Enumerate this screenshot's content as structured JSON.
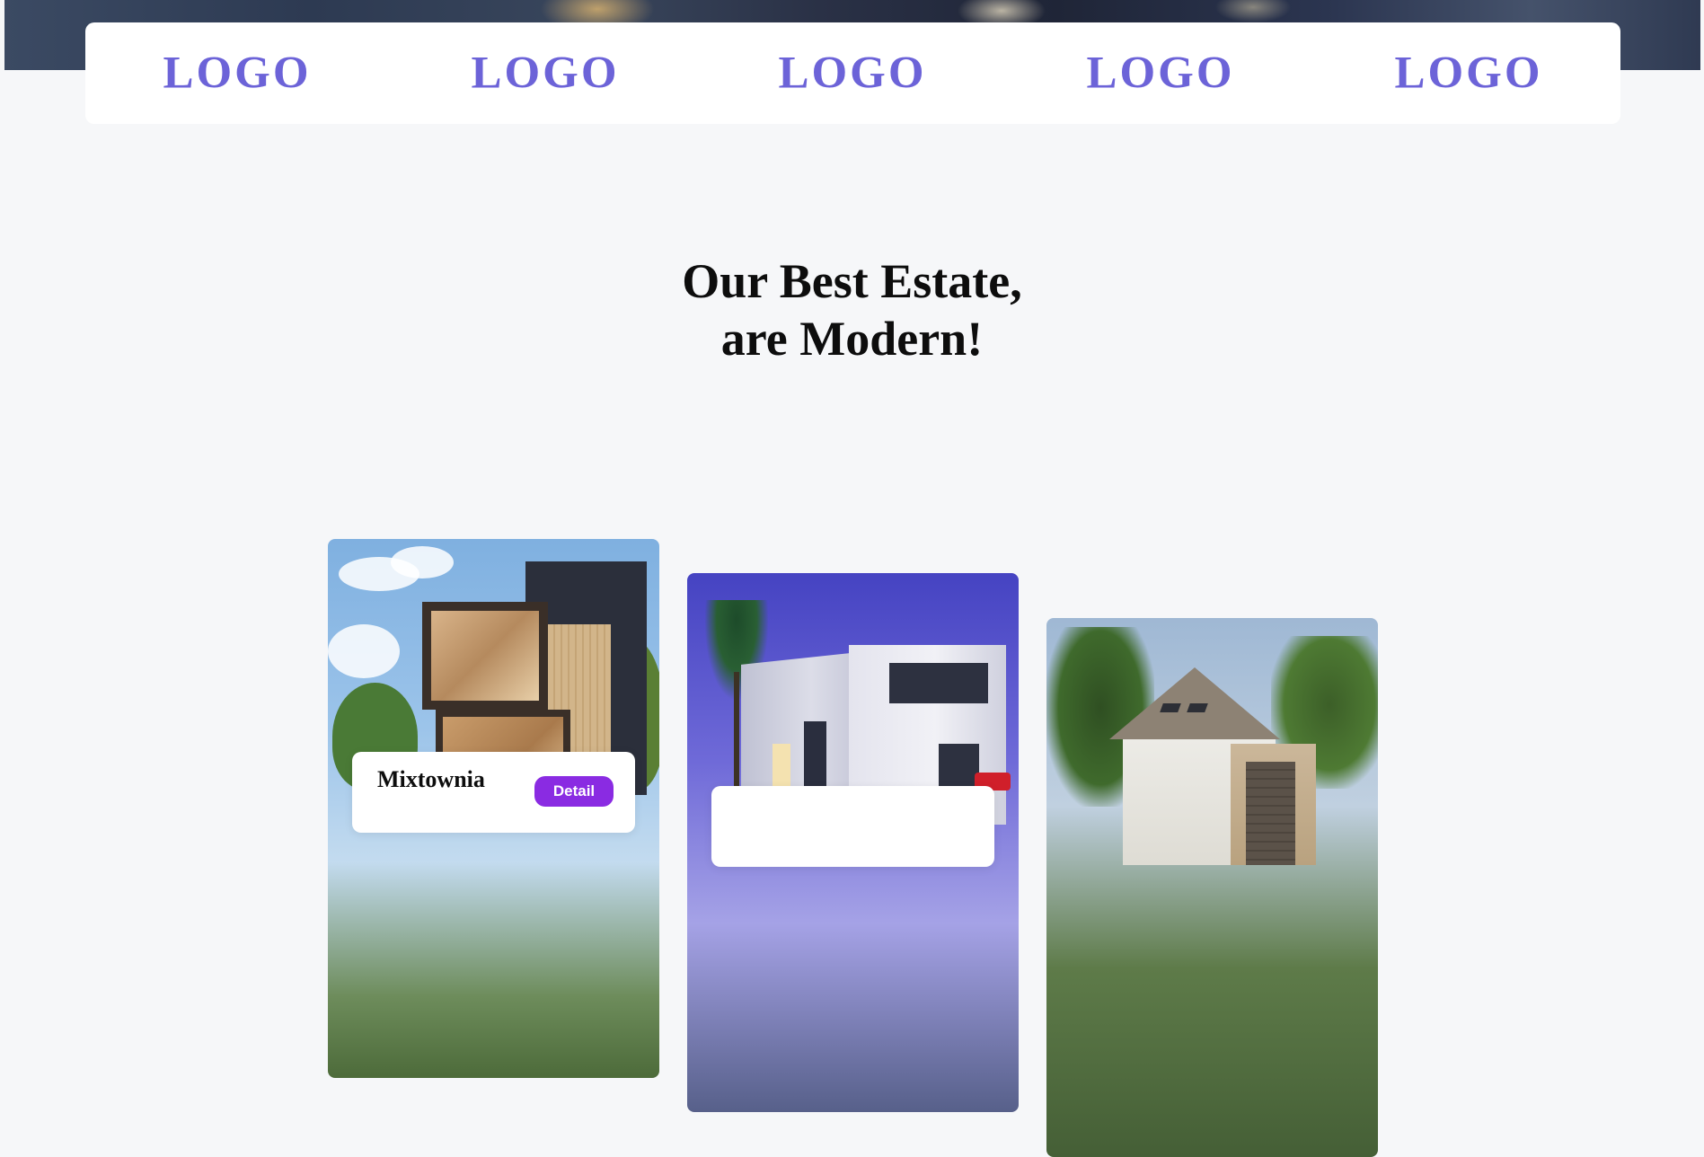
{
  "partners": {
    "logos": [
      "LOGO",
      "LOGO",
      "LOGO",
      "LOGO",
      "LOGO"
    ]
  },
  "section": {
    "title_line_1": "Our Best Estate,",
    "title_line_2": "are Modern!"
  },
  "estates": [
    {
      "name": "Mixtownia",
      "detail_label": "Detail"
    },
    {
      "name": "",
      "detail_label": ""
    },
    {
      "name": "",
      "detail_label": ""
    }
  ],
  "colors": {
    "logo": "#6c63d8",
    "accent": "#8a2be2",
    "page_background": "#f6f7f9",
    "heading": "#0d0d0d"
  }
}
